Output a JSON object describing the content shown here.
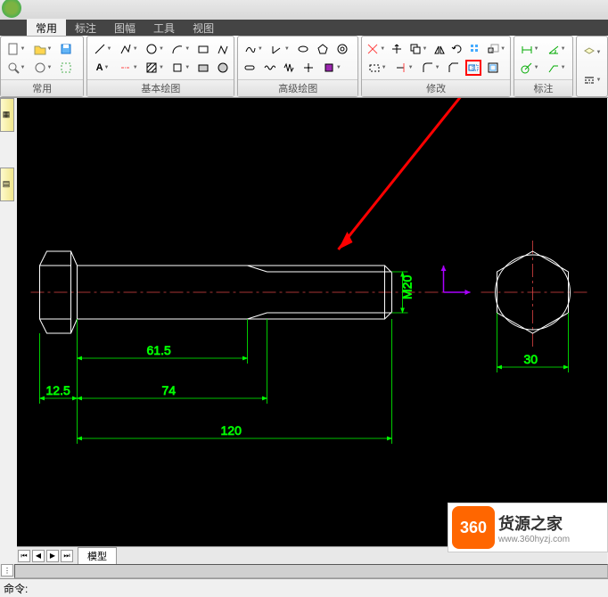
{
  "menu": {
    "common": "常用",
    "annotate": "标注",
    "sheet": "图幅",
    "tools": "工具",
    "view": "视图"
  },
  "panels": {
    "common": "常用",
    "basic_draw": "基本绘图",
    "adv_draw": "高级绘图",
    "modify": "修改",
    "dimension": "标注"
  },
  "sheet_tab": "模型",
  "cmd_prompt": "命令:",
  "watermark": {
    "badge": "360",
    "title": "货源之家",
    "url": "www.360hyzj.com"
  },
  "dims": {
    "d1": "12.5",
    "d2": "61.5",
    "d3": "74",
    "d4": "120",
    "d5": "30",
    "thread": "M20"
  }
}
